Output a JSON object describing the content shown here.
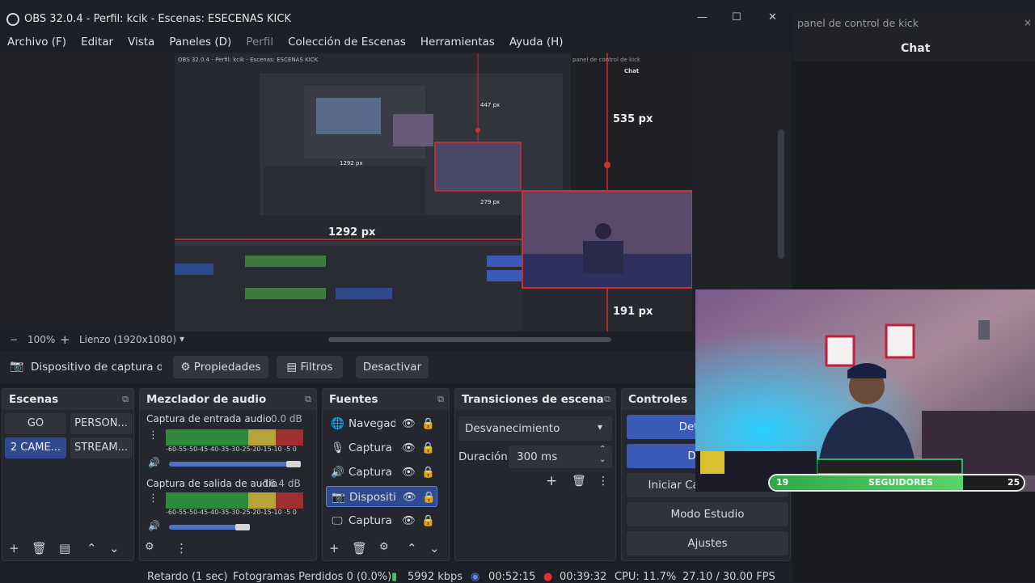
{
  "window": {
    "title": "OBS 32.0.4 - Perfil: kcik - Escenas: ESECENAS KICK",
    "controls": [
      "—",
      "☐",
      "✕"
    ]
  },
  "menu": [
    "Archivo (F)",
    "Editar",
    "Vista",
    "Paneles (D)",
    "Perfil",
    "Colección de Escenas",
    "Herramientas",
    "Ayuda (H)"
  ],
  "preview": {
    "measure_top": "535 px",
    "measure_bottom": "191 px",
    "measure_left": "1292 px",
    "inner_measure_top": "447 px",
    "inner_measure_left": "1292 px",
    "inner_measure_bottom": "279 px",
    "inner_title": "OBS 32.0.4 - Perfil: kcik - Escenas: ESCENAS KICK",
    "inner_panel": "panel de control de kick",
    "inner_chat": "Chat"
  },
  "zoombar": {
    "minus": "−",
    "zoom": "100%",
    "plus": "+",
    "canvas": "Lienzo (1920x1080)"
  },
  "source_toolbar": {
    "source_name": "Dispositivo de captura de v",
    "properties": "Propiedades",
    "filters": "Filtros",
    "deactivate": "Desactivar"
  },
  "scenes": {
    "title": "Escenas",
    "items": [
      {
        "label": "GO",
        "selected": false
      },
      {
        "label": "PERSON...",
        "selected": false
      },
      {
        "label": "2 CAME...",
        "selected": true
      },
      {
        "label": "STREAM...",
        "selected": false
      }
    ]
  },
  "mixer": {
    "title": "Mezclador de audio",
    "channels": [
      {
        "name": "Captura de entrada audio",
        "db": "0.0 dB",
        "volume": 0.93
      },
      {
        "name": "Captura de salida de audio",
        "db": "-16.4 dB",
        "volume": 0.55
      }
    ],
    "ticks": "-60-55-50-45-40-35-30-25-20-15-10 -5  0"
  },
  "sources": {
    "title": "Fuentes",
    "items": [
      {
        "icon": "globe",
        "name": "Navegador",
        "selected": false
      },
      {
        "icon": "mic",
        "name": "Captura de",
        "selected": false
      },
      {
        "icon": "speaker",
        "name": "Captura de",
        "selected": false
      },
      {
        "icon": "camera",
        "name": "Dispositivo",
        "selected": true
      },
      {
        "icon": "monitor",
        "name": "Captura de",
        "selected": false
      }
    ]
  },
  "transitions": {
    "title": "Transiciones de escena",
    "selected": "Desvanecimiento",
    "duration_label": "Duración",
    "duration_value": "300 ms"
  },
  "controls": {
    "title": "Controles",
    "buttons": [
      "Detener Tr",
      "Detene",
      "Iniciar Cámara Virtual",
      "Modo Estudio",
      "Ajustes"
    ]
  },
  "status": {
    "delay": "Retardo (1 sec)",
    "dropped": "Fotogramas Perdidos 0 (0.0%)",
    "bitrate": "5992 kbps",
    "stream_time": "00:52:15",
    "rec_time": "00:39:32",
    "cpu": "CPU: 11.7%",
    "fps": "27.10 / 30.00 FPS"
  },
  "right_panel": {
    "title": "panel de control de kick",
    "close": "×",
    "chat": "Chat"
  },
  "overlay": {
    "count_left": "19",
    "label": "SEGUIDORES",
    "count_right": "25",
    "progress": 0.76
  },
  "colors": {
    "accent": "#3b5ab8",
    "selection_red": "#d23030",
    "live_green": "#3ec95a"
  }
}
